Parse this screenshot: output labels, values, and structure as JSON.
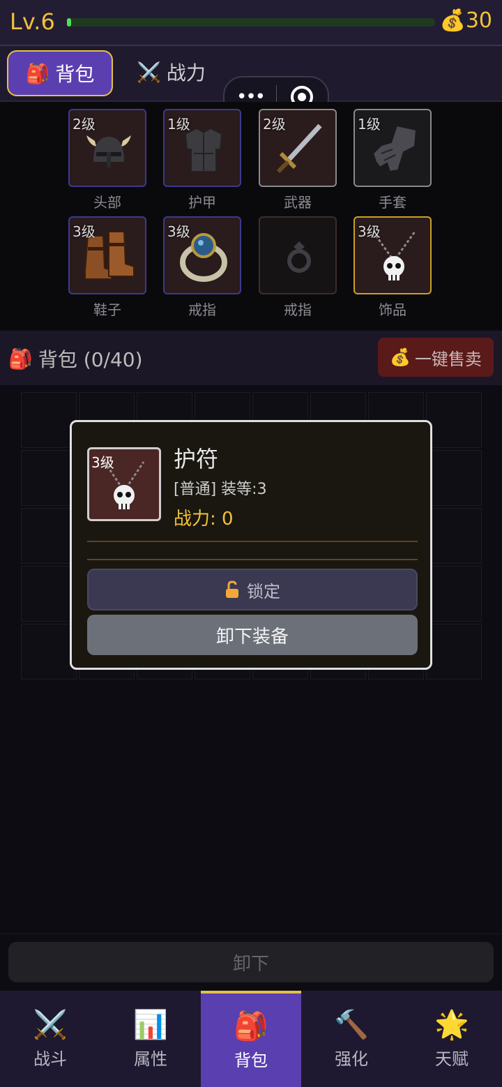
{
  "header": {
    "level": "Lv.6",
    "xp_fraction": 0.01,
    "gold": "30"
  },
  "tabs": [
    {
      "label": "背包"
    },
    {
      "label": "战力"
    }
  ],
  "equipment": [
    {
      "level": "2级",
      "label": "头部"
    },
    {
      "level": "1级",
      "label": "护甲"
    },
    {
      "level": "2级",
      "label": "武器"
    },
    {
      "level": "1级",
      "label": "手套"
    },
    {
      "level": "3级",
      "label": "鞋子"
    },
    {
      "level": "3级",
      "label": "戒指"
    },
    {
      "level": "",
      "label": "戒指"
    },
    {
      "level": "3级",
      "label": "饰品"
    }
  ],
  "bag": {
    "title": "背包 (0/40)",
    "sell_all": "一键售卖"
  },
  "modal": {
    "level": "3级",
    "name": "护符",
    "desc": "[普通] 装等:3",
    "power": "战力: 0",
    "lock_label": "锁定",
    "unequip_label": "卸下装备"
  },
  "bottom_action": "卸下",
  "nav": [
    {
      "label": "战斗",
      "icon": "crossed-swords-icon"
    },
    {
      "label": "属性",
      "icon": "bar-chart-icon"
    },
    {
      "label": "背包",
      "icon": "backpack-icon"
    },
    {
      "label": "强化",
      "icon": "hammer-icon"
    },
    {
      "label": "天赋",
      "icon": "star-burst-icon"
    }
  ],
  "colors": {
    "accent": "#5a3fb0",
    "gold": "#f3c13a",
    "sell": "#5a1a1a"
  }
}
